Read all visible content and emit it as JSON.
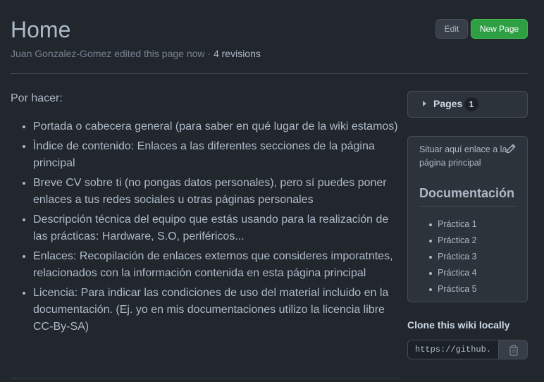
{
  "header": {
    "title": "Home",
    "author": "Juan Gonzalez-Gomez",
    "edited_text": " edited this page now · ",
    "revisions": "4 revisions",
    "edit_label": "Edit",
    "new_page_label": "New Page"
  },
  "content": {
    "intro": "Por hacer:",
    "items": [
      "Portada o cabecera general (para saber en qué lugar de la wiki estamos)",
      "Ìndice de contenido: Enlaces a las diferentes secciones de la página principal",
      "Breve CV sobre ti (no pongas datos personales), pero sí puedes poner enlaces a tus redes sociales u otras páginas personales",
      "Descripción técnica del equipo que estás usando para la realización de las prácticas: Hardware, S.O, periféricos...",
      "Enlaces: Recopilación de enlaces externos que consideres imporatntes, relacionados con la información contenida en esta página principal",
      "Licencia: Para indicar las condiciones de uso del material incluido en la documentación. (Ej. yo en mis documentaciones utilizo la licencia libre CC-By-SA)"
    ]
  },
  "sidebar": {
    "pages_label": "Pages",
    "pages_count": "1",
    "note": "Situar aquí enlace a la página principal",
    "doc_title": "Documentación",
    "links": [
      "Práctica 1",
      "Práctica 2",
      "Práctica 3",
      "Práctica 4",
      "Práctica 5"
    ],
    "clone_title": "Clone this wiki locally",
    "clone_url": "https://github."
  },
  "colors": {
    "background": "#22272e",
    "accent_green": "#2ea043",
    "text": "#adbac7"
  },
  "icons": [
    "caret-right-icon",
    "pencil-icon",
    "clipboard-icon"
  ]
}
